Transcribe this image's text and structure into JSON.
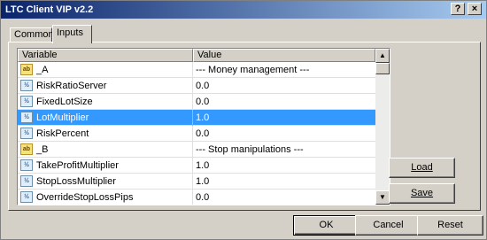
{
  "window": {
    "title": "LTC Client VIP v2.2",
    "help_label": "?",
    "close_label": "×"
  },
  "tabs": [
    {
      "label": "Common",
      "active": false
    },
    {
      "label": "Inputs",
      "active": true
    }
  ],
  "grid": {
    "columns": [
      "Variable",
      "Value"
    ],
    "rows": [
      {
        "icon": "string-icon",
        "icon_text": "ab",
        "name": "_A",
        "value": "--- Money management ---",
        "selected": false
      },
      {
        "icon": "numeric-icon",
        "icon_text": "½",
        "name": "RiskRatioServer",
        "value": "0.0",
        "selected": false
      },
      {
        "icon": "numeric-icon",
        "icon_text": "½",
        "name": "FixedLotSize",
        "value": "0.0",
        "selected": false
      },
      {
        "icon": "numeric-icon",
        "icon_text": "½",
        "name": "LotMultiplier",
        "value": "1.0",
        "selected": true
      },
      {
        "icon": "numeric-icon",
        "icon_text": "½",
        "name": "RiskPercent",
        "value": "0.0",
        "selected": false
      },
      {
        "icon": "string-icon",
        "icon_text": "ab",
        "name": "_B",
        "value": "--- Stop manipulations ---",
        "selected": false
      },
      {
        "icon": "numeric-icon",
        "icon_text": "½",
        "name": "TakeProfitMultiplier",
        "value": "1.0",
        "selected": false
      },
      {
        "icon": "numeric-icon",
        "icon_text": "½",
        "name": "StopLossMultiplier",
        "value": "1.0",
        "selected": false
      },
      {
        "icon": "numeric-icon",
        "icon_text": "½",
        "name": "OverrideStopLossPips",
        "value": "0.0",
        "selected": false
      }
    ]
  },
  "side_buttons": {
    "load_label": "Load",
    "save_label": "Save"
  },
  "footer": {
    "ok_label": "OK",
    "cancel_label": "Cancel",
    "reset_label": "Reset"
  },
  "colors": {
    "selection": "#3399ff",
    "title_start": "#0a246a",
    "title_end": "#a6caf0",
    "face": "#d4d0c8"
  }
}
